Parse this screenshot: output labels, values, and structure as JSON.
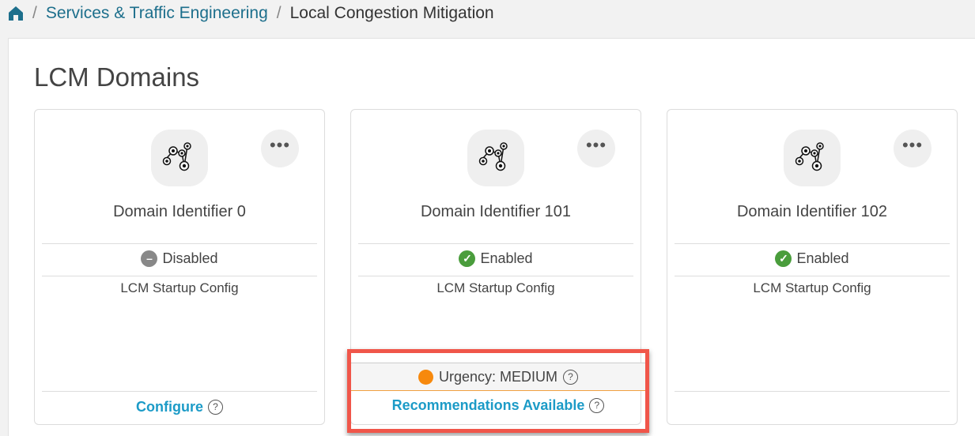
{
  "breadcrumb": {
    "items": [
      "Services & Traffic Engineering",
      "Local Congestion Mitigation"
    ]
  },
  "page_title": "LCM Domains",
  "colors": {
    "link": "#1c9bc7",
    "enabled": "#4a9d3c",
    "disabled": "#888888",
    "urgency_medium": "#f7890d",
    "highlight": "#f0564a"
  },
  "cards": [
    {
      "title": "Domain Identifier 0",
      "status": "Disabled",
      "config": "LCM Startup Config",
      "action": "Configure",
      "more": "•••"
    },
    {
      "title": "Domain Identifier 101",
      "status": "Enabled",
      "config": "LCM Startup Config",
      "urgency": "Urgency: MEDIUM",
      "action": "Recommendations Available",
      "more": "•••"
    },
    {
      "title": "Domain Identifier 102",
      "status": "Enabled",
      "config": "LCM Startup Config",
      "more": "•••"
    }
  ],
  "help": "?"
}
